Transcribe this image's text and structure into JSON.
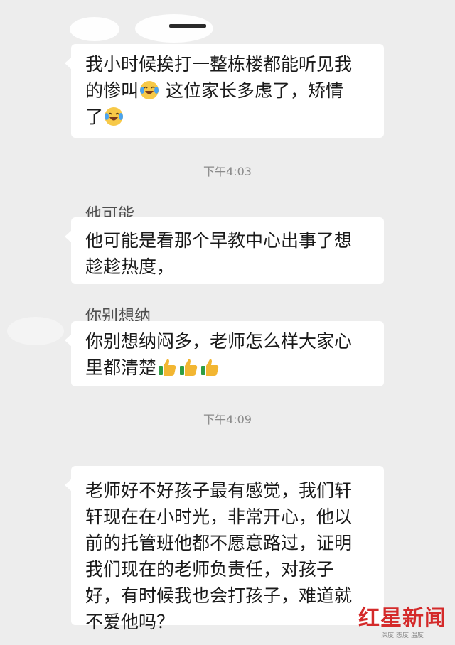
{
  "messages": [
    {
      "lines": [
        "我小时候挨打一整栋楼都能听见我",
        "的惨叫{emoji} 这位家长多虑了，矫情",
        "了{emoji}"
      ],
      "emoji": "laughing-crying-emoji"
    },
    {
      "quote": "他可能",
      "lines": [
        "他可能是看那个早教中心出事了想",
        "趁趁热度，"
      ]
    },
    {
      "quote": "你别想纳",
      "lines": [
        "你别想纳闷多，老师怎么样大家心",
        "里都清楚"
      ],
      "emoji": "thumbs-up-emoji",
      "emoji_count": 3
    },
    {
      "lines": [
        "老师好不好孩子最有感觉，我们轩",
        "轩现在在小时光，非常开心，他以",
        "前的托管班他都不愿意路过，证明",
        "我们现在的老师负责任，对孩子",
        "好，有时候我也会打孩子，难道就",
        "不爱他吗？"
      ]
    }
  ],
  "timestamps": [
    "下午4:03",
    "下午4:09"
  ],
  "watermark": {
    "main": "红星新闻",
    "sub": "深度 态度 温度"
  },
  "colors": {
    "background": "#ededed",
    "bubble": "#ffffff",
    "timestamp": "#8a8a8a",
    "watermark": "#d42a2a"
  }
}
